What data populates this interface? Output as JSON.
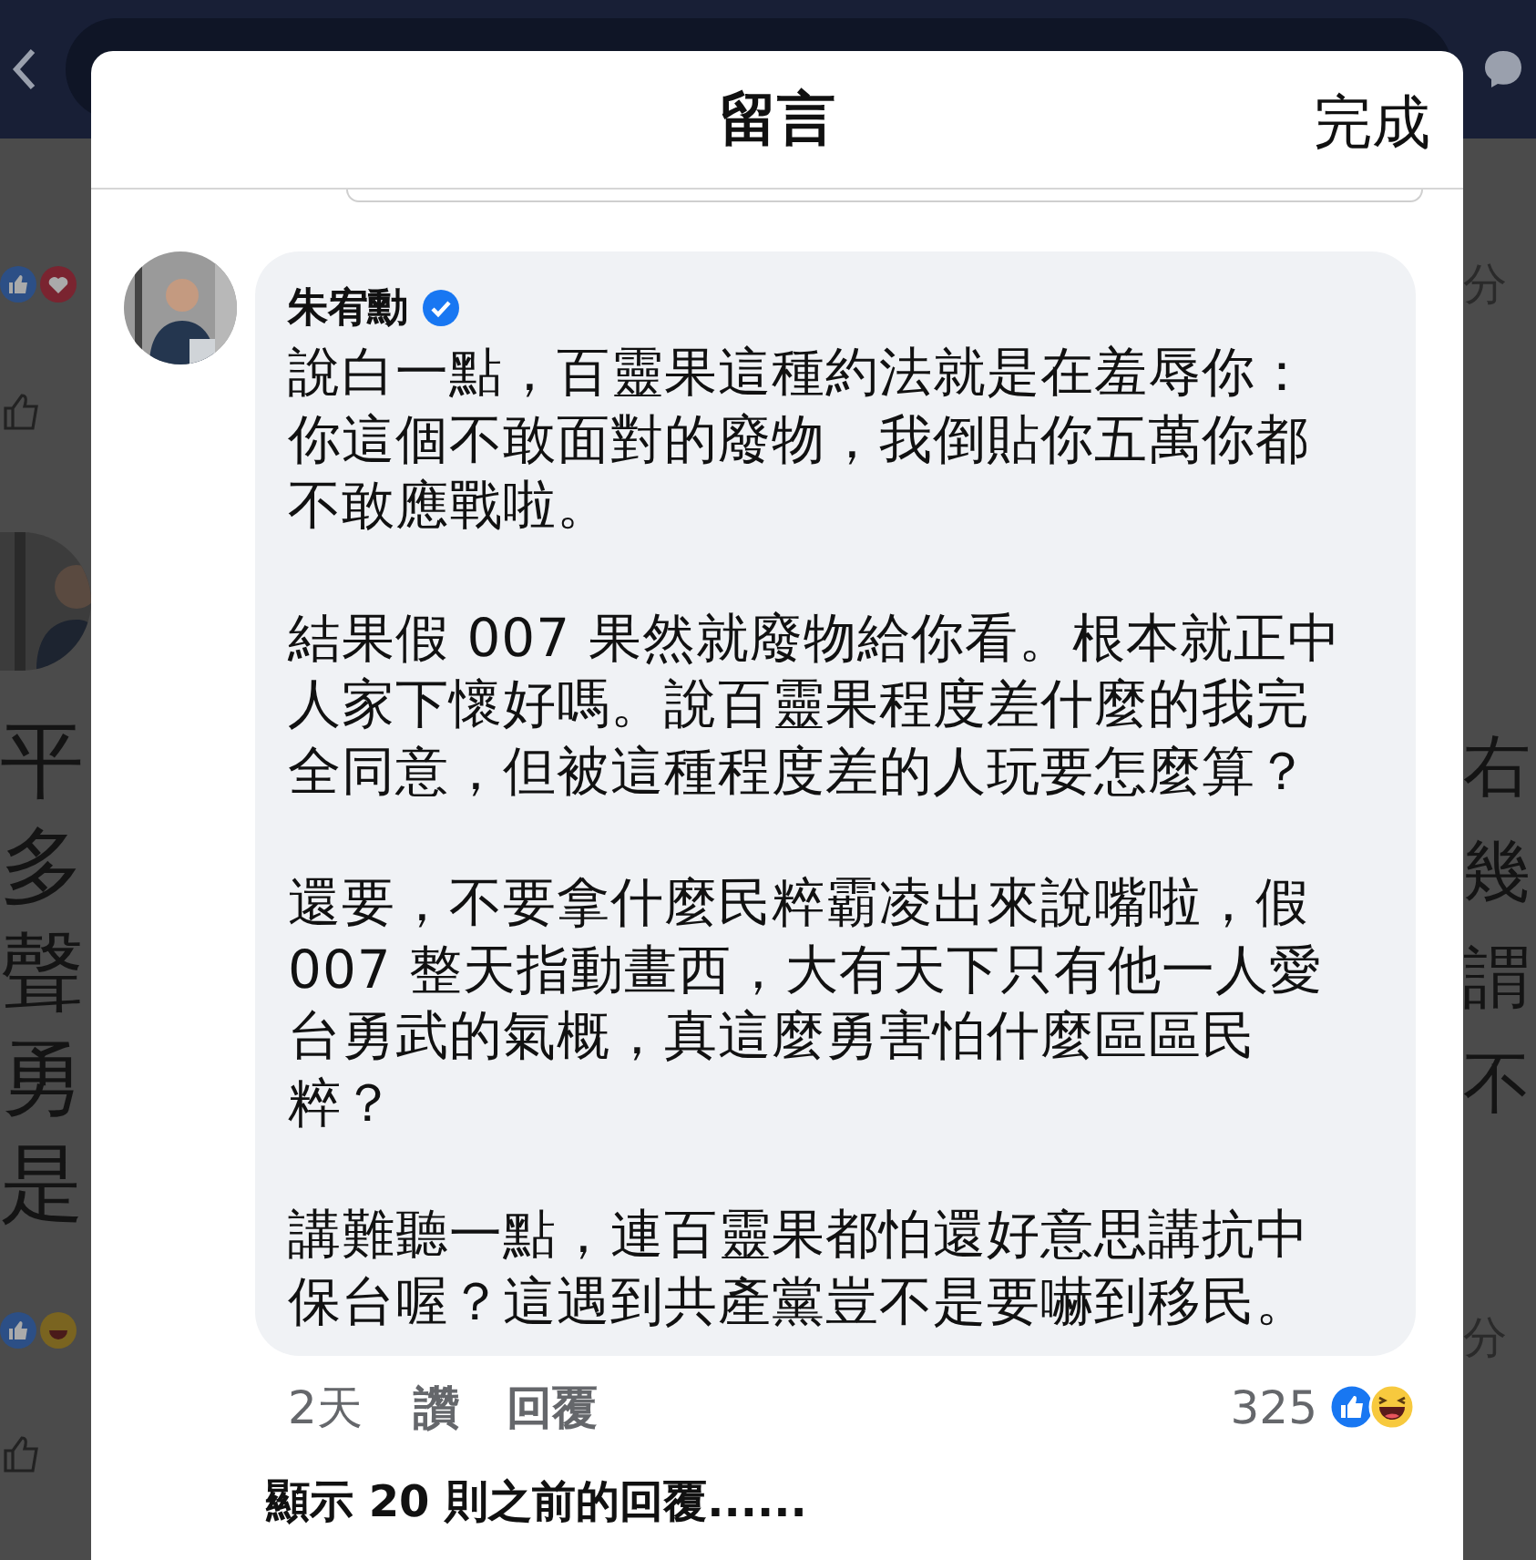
{
  "background_post": {
    "left_text_fragments": [
      "平",
      "多",
      "聲",
      "勇",
      "是"
    ],
    "right_text_fragments": [
      "右",
      "幾",
      "謂",
      "不"
    ],
    "share_labels": [
      "分",
      "分"
    ]
  },
  "dialog": {
    "title": "留言",
    "done_button": "完成"
  },
  "comment": {
    "author": "朱宥勳",
    "verified": true,
    "paragraphs": [
      [
        "說白一點，百靈果這種約法就是在羞辱你：",
        "你這個不敢面對的廢物，我倒貼你五萬你都",
        "不敢應戰啦。"
      ],
      [
        "結果假 007 果然就廢物給你看。根本就正中",
        "人家下懷好嗎。說百靈果程度差什麼的我完",
        "全同意，但被這種程度差的人玩要怎麼算？"
      ],
      [
        "還要，不要拿什麼民粹霸凌出來說嘴啦，假",
        "007 整天指動畫西，大有天下只有他一人愛",
        "台勇武的氣概，真這麼勇害怕什麼區區民",
        "粹？"
      ],
      [
        "講難聽一點，連百靈果都怕還好意思講抗中",
        "保台喔？這遇到共產黨豈不是要嚇到移民。"
      ]
    ],
    "time": "2天",
    "like_action": "讚",
    "reply_action": "回覆",
    "reaction_count": "325"
  },
  "more_replies": "顯示 20 則之前的回覆......"
}
